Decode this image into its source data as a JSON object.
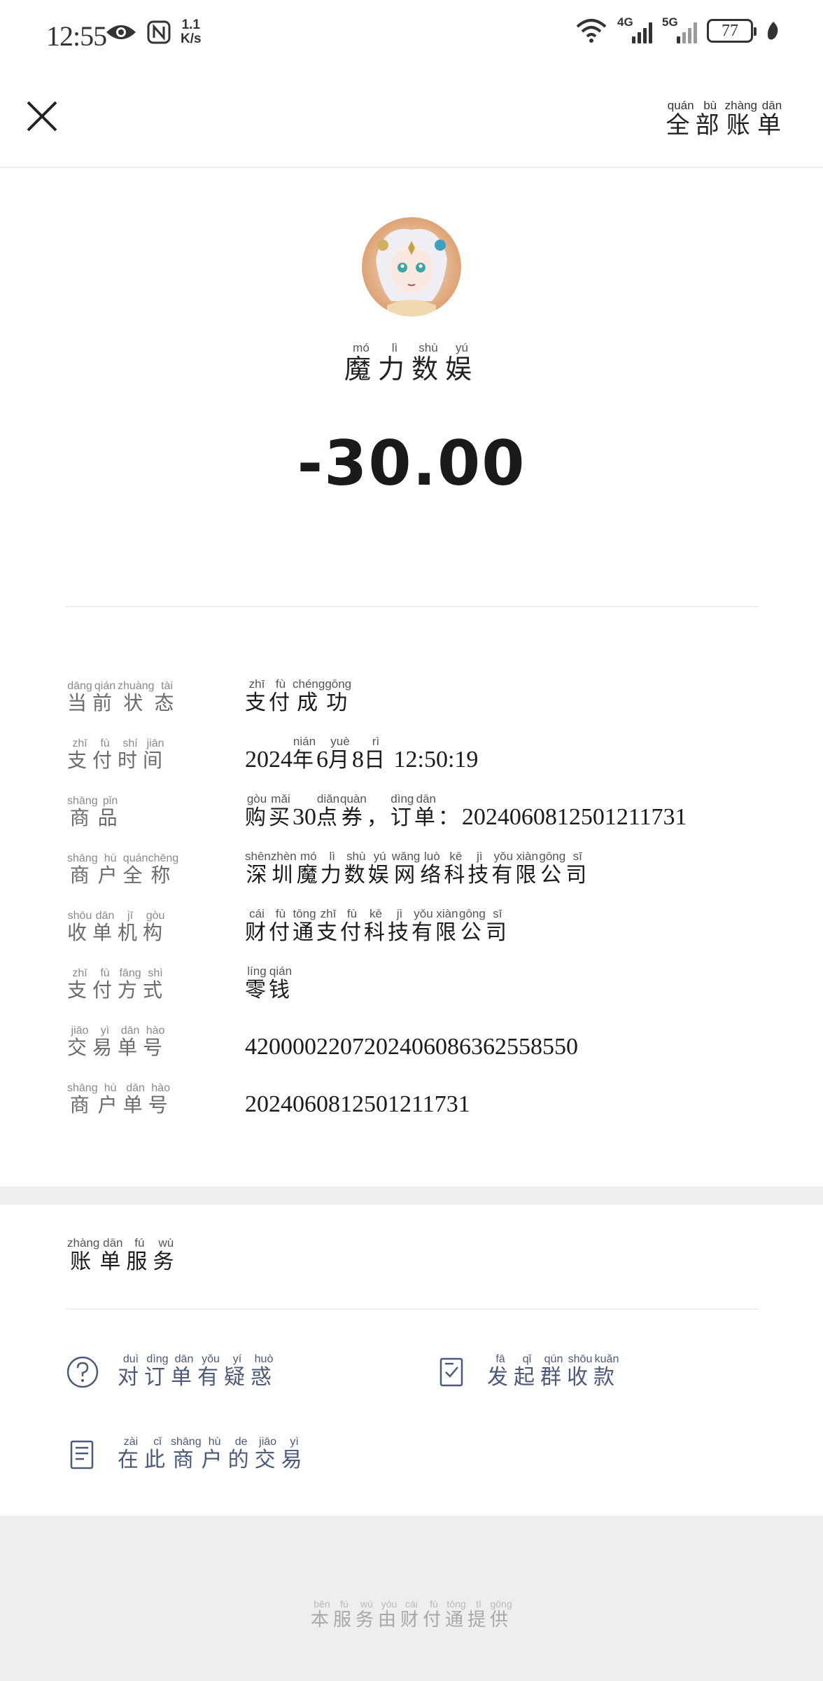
{
  "status_bar": {
    "time": "12:55",
    "speed_value": "1.1",
    "speed_unit": "K/s",
    "net1": "4G",
    "net2": "5G",
    "battery": "77"
  },
  "header": {
    "all_bills": [
      {
        "c": "全",
        "p": "quán"
      },
      {
        "c": "部",
        "p": "bù"
      },
      {
        "c": "账",
        "p": "zhàng"
      },
      {
        "c": "单",
        "p": "dān"
      }
    ]
  },
  "merchant": {
    "name": [
      {
        "c": "魔",
        "p": "mó"
      },
      {
        "c": "力",
        "p": "lì"
      },
      {
        "c": "数",
        "p": "shù"
      },
      {
        "c": "娱",
        "p": "yú"
      }
    ],
    "amount": "-30.00"
  },
  "details": [
    {
      "label": [
        {
          "c": "当",
          "p": "dāng"
        },
        {
          "c": "前",
          "p": "qián"
        },
        {
          "c": "状",
          "p": "zhuàng"
        },
        {
          "c": "态",
          "p": "tài"
        }
      ],
      "value": [
        {
          "c": "支",
          "p": "zhī"
        },
        {
          "c": "付",
          "p": "fù"
        },
        {
          "c": "成",
          "p": "chéng"
        },
        {
          "c": "功",
          "p": "gōng"
        }
      ]
    },
    {
      "label": [
        {
          "c": "支",
          "p": "zhī"
        },
        {
          "c": "付",
          "p": "fù"
        },
        {
          "c": "时",
          "p": "shí"
        },
        {
          "c": "间",
          "p": "jiān"
        }
      ],
      "value": [
        {
          "n": "2024"
        },
        {
          "c": "年",
          "p": "nián"
        },
        {
          "n": "6"
        },
        {
          "c": "月",
          "p": "yuè"
        },
        {
          "n": "8"
        },
        {
          "c": "日",
          "p": "rì"
        },
        {
          "n": "  12:50:19"
        }
      ]
    },
    {
      "label": [
        {
          "c": "商",
          "p": "shāng"
        },
        {
          "c": "品",
          "p": "pǐn"
        }
      ],
      "value": [
        {
          "c": "购",
          "p": "gòu"
        },
        {
          "c": "买",
          "p": "mǎi"
        },
        {
          "n": "30"
        },
        {
          "c": "点",
          "p": "diǎn"
        },
        {
          "c": "券",
          "p": "quàn"
        },
        {
          "c": "，",
          "p": ""
        },
        {
          "c": "订",
          "p": "dìng"
        },
        {
          "c": "单",
          "p": "dān"
        },
        {
          "c": "：",
          "p": ""
        },
        {
          "n": "2024060812501211731"
        }
      ]
    },
    {
      "label": [
        {
          "c": "商",
          "p": "shāng"
        },
        {
          "c": "户",
          "p": "hù"
        },
        {
          "c": "全",
          "p": "quán"
        },
        {
          "c": "称",
          "p": "chēng"
        }
      ],
      "value": [
        {
          "c": "深",
          "p": "shēn"
        },
        {
          "c": "圳",
          "p": "zhèn"
        },
        {
          "c": "魔",
          "p": "mó"
        },
        {
          "c": "力",
          "p": "lì"
        },
        {
          "c": "数",
          "p": "shù"
        },
        {
          "c": "娱",
          "p": "yú"
        },
        {
          "c": "网",
          "p": "wǎng"
        },
        {
          "c": "络",
          "p": "luò"
        },
        {
          "c": "科",
          "p": "kē"
        },
        {
          "c": "技",
          "p": "jì"
        },
        {
          "c": "有",
          "p": "yǒu"
        },
        {
          "c": "限",
          "p": "xiàn"
        },
        {
          "c": "公",
          "p": "gōng"
        },
        {
          "c": "司",
          "p": "sī"
        }
      ]
    },
    {
      "label": [
        {
          "c": "收",
          "p": "shōu"
        },
        {
          "c": "单",
          "p": "dān"
        },
        {
          "c": "机",
          "p": "jī"
        },
        {
          "c": "构",
          "p": "gòu"
        }
      ],
      "value": [
        {
          "c": "财",
          "p": "cái"
        },
        {
          "c": "付",
          "p": "fù"
        },
        {
          "c": "通",
          "p": "tōng"
        },
        {
          "c": "支",
          "p": "zhī"
        },
        {
          "c": "付",
          "p": "fù"
        },
        {
          "c": "科",
          "p": "kē"
        },
        {
          "c": "技",
          "p": "jì"
        },
        {
          "c": "有",
          "p": "yǒu"
        },
        {
          "c": "限",
          "p": "xiàn"
        },
        {
          "c": "公",
          "p": "gōng"
        },
        {
          "c": "司",
          "p": "sī"
        }
      ]
    },
    {
      "label": [
        {
          "c": "支",
          "p": "zhī"
        },
        {
          "c": "付",
          "p": "fù"
        },
        {
          "c": "方",
          "p": "fāng"
        },
        {
          "c": "式",
          "p": "shì"
        }
      ],
      "value": [
        {
          "c": "零",
          "p": "líng"
        },
        {
          "c": "钱",
          "p": "qián"
        }
      ]
    },
    {
      "label": [
        {
          "c": "交",
          "p": "jiāo"
        },
        {
          "c": "易",
          "p": "yì"
        },
        {
          "c": "单",
          "p": "dān"
        },
        {
          "c": "号",
          "p": "hào"
        }
      ],
      "value": [
        {
          "n": "4200002207202406086362558550"
        }
      ]
    },
    {
      "label": [
        {
          "c": "商",
          "p": "shāng"
        },
        {
          "c": "户",
          "p": "hù"
        },
        {
          "c": "单",
          "p": "dān"
        },
        {
          "c": "号",
          "p": "hào"
        }
      ],
      "value": [
        {
          "n": "2024060812501211731"
        }
      ]
    }
  ],
  "services": {
    "title": [
      {
        "c": "账",
        "p": "zhàng"
      },
      {
        "c": "单",
        "p": "dān"
      },
      {
        "c": "服",
        "p": "fú"
      },
      {
        "c": "务",
        "p": "wù"
      }
    ],
    "items": [
      {
        "icon": "question-circle-icon",
        "text": [
          {
            "c": "对",
            "p": "duì"
          },
          {
            "c": "订",
            "p": "dìng"
          },
          {
            "c": "单",
            "p": "dān"
          },
          {
            "c": "有",
            "p": "yǒu"
          },
          {
            "c": "疑",
            "p": "yí"
          },
          {
            "c": "惑",
            "p": "huò"
          }
        ]
      },
      {
        "icon": "group-collect-icon",
        "text": [
          {
            "c": "发",
            "p": "fā"
          },
          {
            "c": "起",
            "p": "qǐ"
          },
          {
            "c": "群",
            "p": "qún"
          },
          {
            "c": "收",
            "p": "shōu"
          },
          {
            "c": "款",
            "p": "kuǎn"
          }
        ]
      },
      {
        "icon": "document-icon",
        "text": [
          {
            "c": "在",
            "p": "zài"
          },
          {
            "c": "此",
            "p": "cǐ"
          },
          {
            "c": "商",
            "p": "shāng"
          },
          {
            "c": "户",
            "p": "hù"
          },
          {
            "c": "的",
            "p": "de"
          },
          {
            "c": "交",
            "p": "jiāo"
          },
          {
            "c": "易",
            "p": "yì"
          }
        ]
      }
    ]
  },
  "footer": {
    "text": [
      {
        "c": "本",
        "p": "běn"
      },
      {
        "c": "服",
        "p": "fú"
      },
      {
        "c": "务",
        "p": "wù"
      },
      {
        "c": "由",
        "p": "yóu"
      },
      {
        "c": "财",
        "p": "cái"
      },
      {
        "c": "付",
        "p": "fù"
      },
      {
        "c": "通",
        "p": "tōng"
      },
      {
        "c": "提",
        "p": "tí"
      },
      {
        "c": "供",
        "p": "gōng"
      }
    ]
  }
}
